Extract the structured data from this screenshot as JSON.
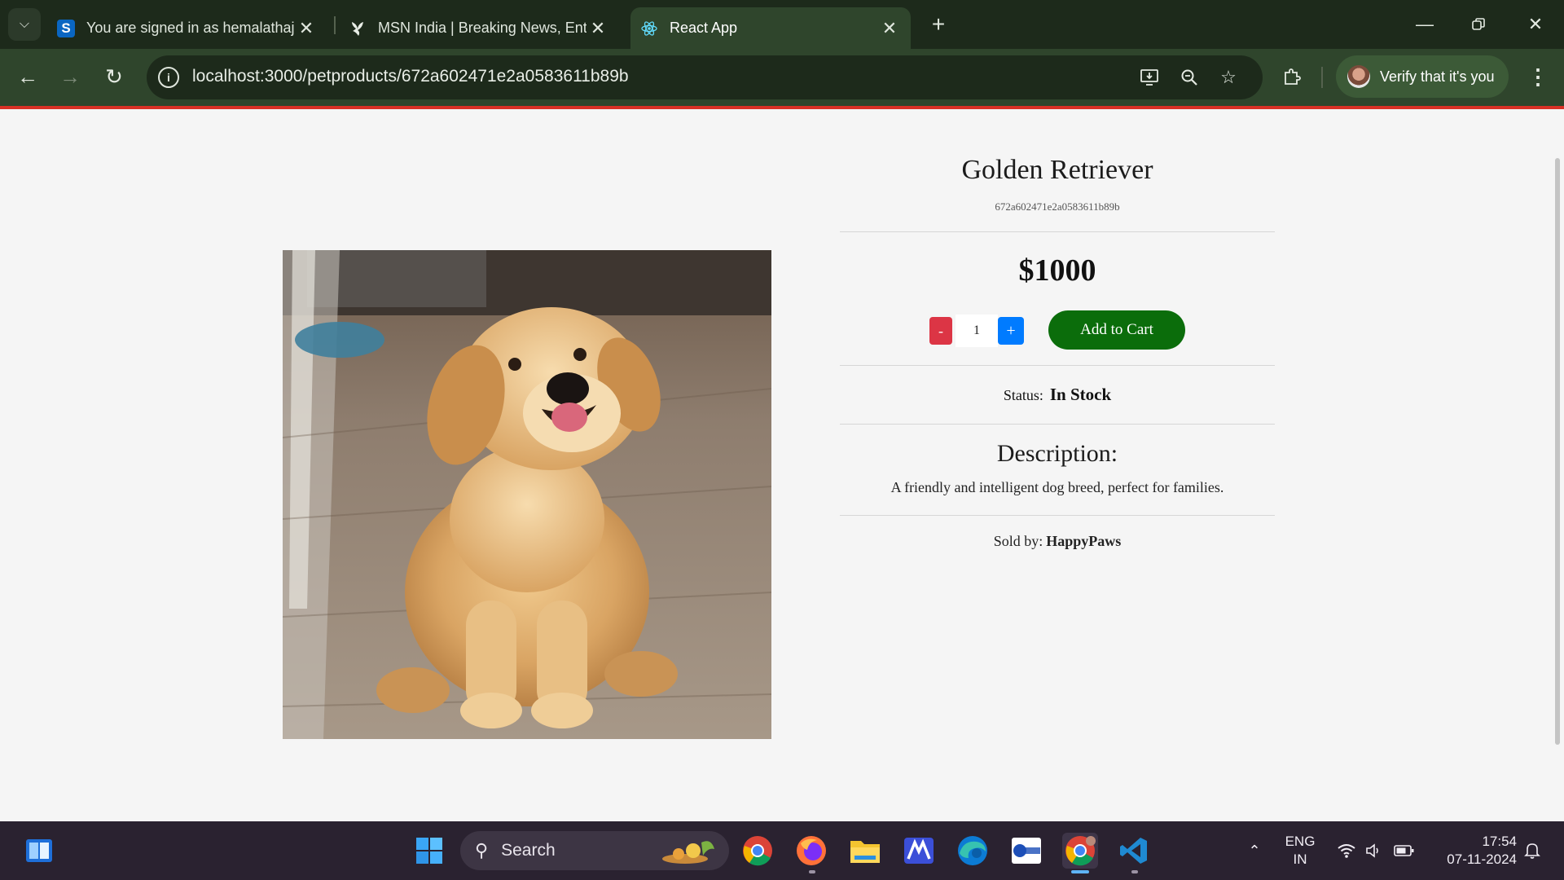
{
  "browser": {
    "tabs": [
      {
        "title": "You are signed in as hemalathaj",
        "favicon": "S",
        "favicon_color": "#0a66c2"
      },
      {
        "title": "MSN India | Breaking News, Ent",
        "favicon": "msn-butterfly-icon"
      },
      {
        "title": "React App",
        "favicon": "react-icon",
        "active": true
      }
    ],
    "url": "localhost:3000/petproducts/672a602471e2a0583611b89b",
    "profile_label": "Verify that it's you"
  },
  "product": {
    "name": "Golden Retriever",
    "id": "672a602471e2a0583611b89b",
    "price": "$1000",
    "quantity": "1",
    "minus_label": "-",
    "plus_label": "+",
    "add_to_cart_label": "Add to Cart",
    "status_label": "Status:",
    "status_value": "In Stock",
    "description_heading": "Description:",
    "description": "A friendly and intelligent dog breed, perfect for families.",
    "sold_by_label": "Sold by:",
    "seller": "HappyPaws",
    "image_alt": "golden retriever puppy"
  },
  "taskbar": {
    "search_placeholder": "Search",
    "lang_top": "ENG",
    "lang_bottom": "IN",
    "time": "17:54",
    "date": "07-11-2024"
  },
  "colors": {
    "minus": "#dc3545",
    "plus": "#007bff",
    "add_to_cart": "#0b6d0b",
    "browser_frame": "#2f452c"
  }
}
